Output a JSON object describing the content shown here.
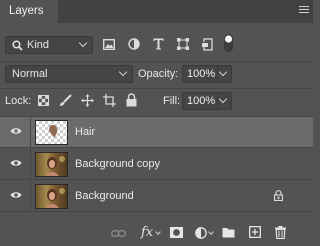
{
  "panel": {
    "title": "Layers"
  },
  "filter": {
    "kind_value": "Kind",
    "toggle_state": "on"
  },
  "blend": {
    "mode_value": "Normal",
    "opacity_label": "Opacity:",
    "opacity_value": "100%"
  },
  "locks": {
    "lock_label": "Lock:",
    "fill_label": "Fill:",
    "fill_value": "100%"
  },
  "layers": [
    {
      "name": "Hair",
      "visible": true,
      "selected": true,
      "locked": false
    },
    {
      "name": "Background copy",
      "visible": true,
      "selected": false,
      "locked": false
    },
    {
      "name": "Background",
      "visible": true,
      "selected": false,
      "locked": true
    }
  ],
  "bottom_toolbar": {
    "fx_label": "fx"
  },
  "colors": {
    "panel_bg": "#535353",
    "selected_row": "#6b6b6b",
    "tab_bar": "#424242"
  },
  "icons": [
    "search-icon",
    "image-filter-icon",
    "adjustment-filter-icon",
    "type-filter-icon",
    "shape-filter-icon",
    "smart-object-filter-icon",
    "filter-toggle-icon",
    "lock-transparent-icon",
    "lock-image-icon",
    "lock-position-icon",
    "lock-artboard-icon",
    "lock-all-icon",
    "eye-icon",
    "lock-icon",
    "link-icon",
    "mask-icon",
    "adjustment-layer-icon",
    "folder-icon",
    "new-layer-icon",
    "trash-icon"
  ]
}
